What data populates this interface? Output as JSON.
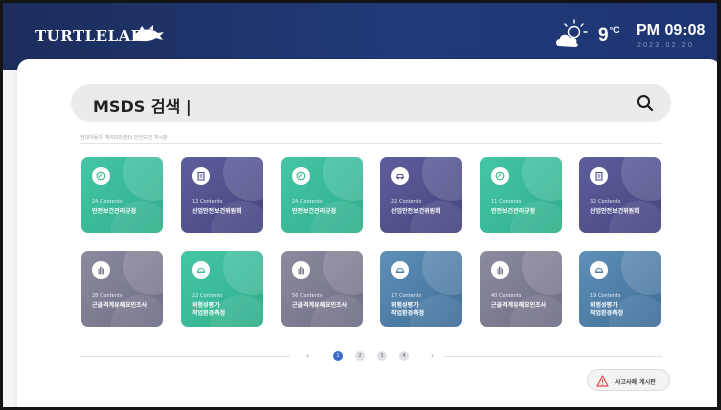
{
  "header": {
    "logo": "TURTLELAB",
    "temperature": "9",
    "temperature_unit": "°C",
    "time": "PM 09:08",
    "date": "2023.02.20",
    "weather": "partly-cloudy-icon"
  },
  "search": {
    "value": "MSDS 검색 |"
  },
  "caption": "현대자동차 캐이피피센터 안전보건 게시판",
  "cards": [
    {
      "count": "24 Contents",
      "title": "안전보건관리규정",
      "color": "green",
      "icon": "leaf-icon"
    },
    {
      "count": "12 Contents",
      "title": "산업안전보건위원회",
      "color": "navy",
      "icon": "clipboard-icon"
    },
    {
      "count": "24 Contents",
      "title": "안전보건관리규정",
      "color": "green",
      "icon": "leaf-icon"
    },
    {
      "count": "22 Contents",
      "title": "산업안전보건위원회",
      "color": "navy",
      "icon": "car-icon"
    },
    {
      "count": "11 Contents",
      "title": "안전보건관리규정",
      "color": "green",
      "icon": "leaf-icon"
    },
    {
      "count": "32 Contents",
      "title": "산업안전보건위원회",
      "color": "navy",
      "icon": "clipboard-icon"
    },
    {
      "count": "28 Contents",
      "title": "근골격계유해요인조사",
      "color": "gray",
      "icon": "hand-icon"
    },
    {
      "count": "22 Contents",
      "title": "위험성평가\n작업환경측정",
      "color": "green",
      "icon": "helmet-icon"
    },
    {
      "count": "56 Contents",
      "title": "근골격계유해요인조사",
      "color": "gray",
      "icon": "hand-icon"
    },
    {
      "count": "17 Contents",
      "title": "위험성평가\n작업환경측정",
      "color": "blue",
      "icon": "helmet-icon"
    },
    {
      "count": "40 Contents",
      "title": "근골격계유해요인조사",
      "color": "gray",
      "icon": "hand-icon"
    },
    {
      "count": "19 Contents",
      "title": "위험성평가\n작업환경측정",
      "color": "blue",
      "icon": "helmet-icon"
    }
  ],
  "pagination": {
    "prev": "‹",
    "next": "›",
    "pages": [
      "1",
      "2",
      "3",
      "4"
    ],
    "current": "1"
  },
  "board_button": {
    "label": "사고사례 게시판",
    "icon": "warning-icon"
  },
  "colors": {
    "green": "#3dbb98",
    "navy": "#50518d",
    "gray": "#7d7c91",
    "blue": "#4f7fa8",
    "accent": "#3a6bc9"
  }
}
